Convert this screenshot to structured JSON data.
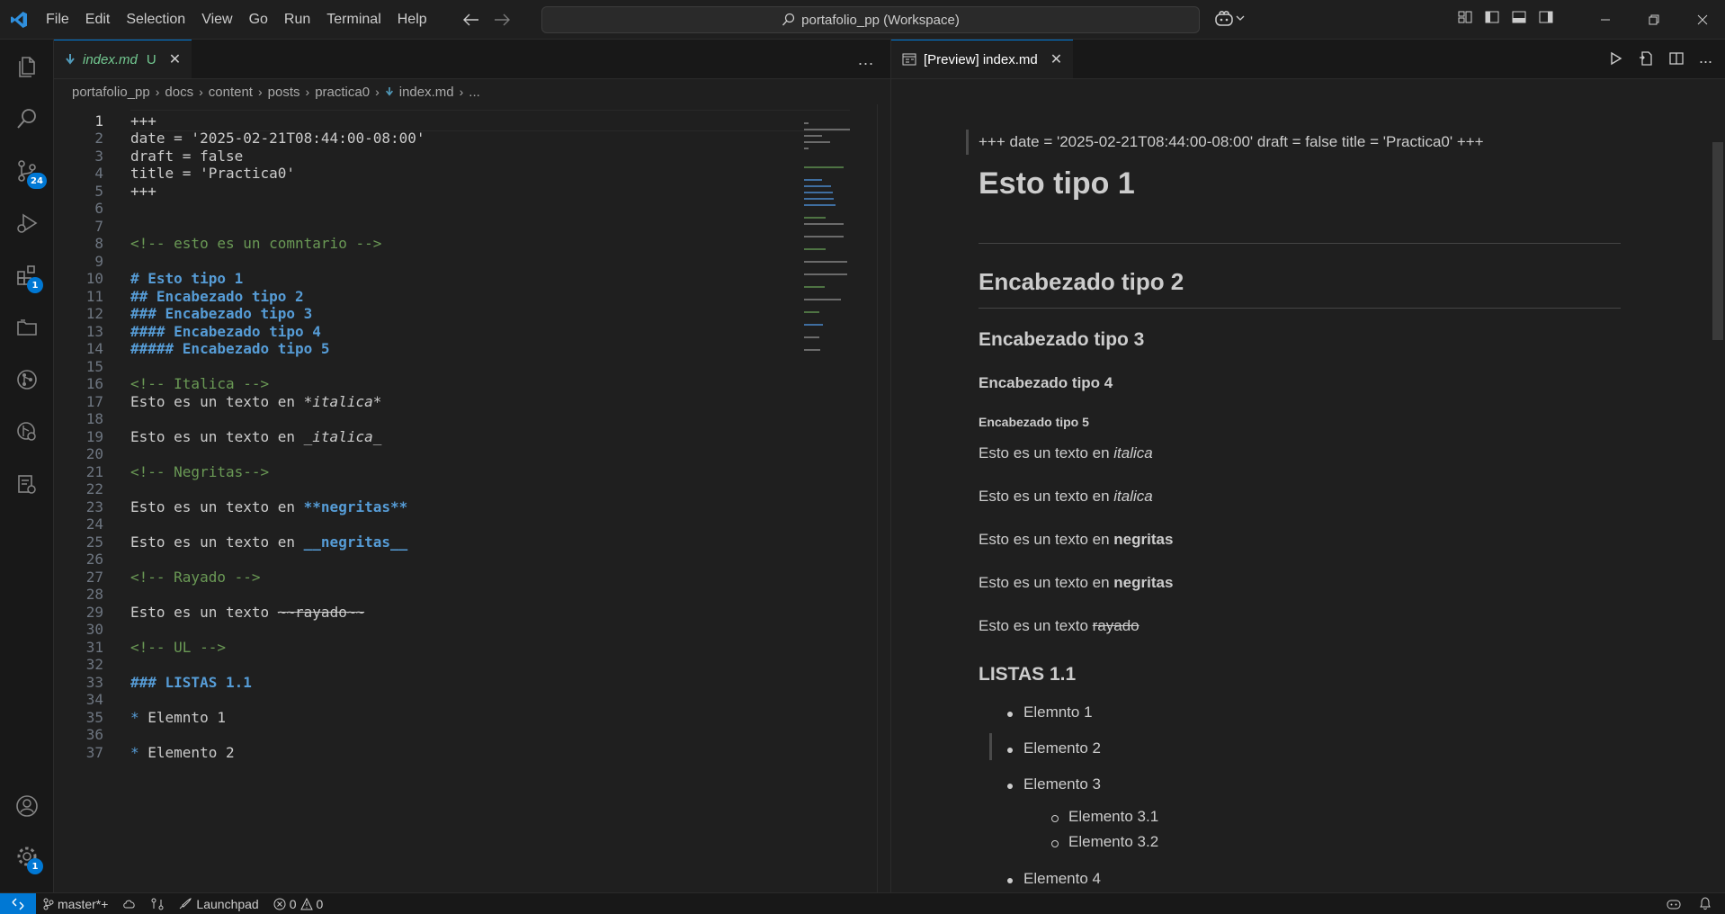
{
  "menu": [
    "File",
    "Edit",
    "Selection",
    "View",
    "Go",
    "Run",
    "Terminal",
    "Help"
  ],
  "search": {
    "text": "portafolio_pp (Workspace)"
  },
  "activity": {
    "scm_badge": "24",
    "extensions_badge": "1",
    "settings_badge": "1"
  },
  "editor": {
    "tab": {
      "title": "index.md",
      "modified": "U"
    },
    "more": "...",
    "breadcrumb": [
      "portafolio_pp",
      "docs",
      "content",
      "posts",
      "practica0",
      "index.md",
      "..."
    ],
    "lines": [
      {
        "n": "1",
        "t": "+++",
        "k": "plain"
      },
      {
        "n": "2",
        "t": "date = '2025-02-21T08:44:00-08:00'",
        "k": "plain"
      },
      {
        "n": "3",
        "t": "draft = false",
        "k": "plain"
      },
      {
        "n": "4",
        "t": "title = 'Practica0'",
        "k": "plain"
      },
      {
        "n": "5",
        "t": "+++",
        "k": "plain"
      },
      {
        "n": "6",
        "t": "",
        "k": "plain"
      },
      {
        "n": "7",
        "t": "",
        "k": "plain"
      },
      {
        "n": "8",
        "t": "<!-- esto es un comntario -->",
        "k": "comment"
      },
      {
        "n": "9",
        "t": "",
        "k": "plain"
      },
      {
        "n": "10",
        "t": "# Esto tipo 1",
        "k": "head"
      },
      {
        "n": "11",
        "t": "## Encabezado tipo 2",
        "k": "head"
      },
      {
        "n": "12",
        "t": "### Encabezado tipo 3",
        "k": "head"
      },
      {
        "n": "13",
        "t": "#### Encabezado tipo 4",
        "k": "head"
      },
      {
        "n": "14",
        "t": "##### Encabezado tipo 5",
        "k": "head"
      },
      {
        "n": "15",
        "t": "",
        "k": "plain"
      },
      {
        "n": "16",
        "t": "<!-- Italica -->",
        "k": "comment"
      },
      {
        "n": "17",
        "pre": "Esto es un texto en ",
        "em": "*italica*",
        "k": "italic"
      },
      {
        "n": "18",
        "t": "",
        "k": "plain"
      },
      {
        "n": "19",
        "pre": "Esto es un texto en ",
        "em": "_italica_",
        "k": "italic"
      },
      {
        "n": "20",
        "t": "",
        "k": "plain"
      },
      {
        "n": "21",
        "t": "<!-- Negritas-->",
        "k": "comment"
      },
      {
        "n": "22",
        "t": "",
        "k": "plain"
      },
      {
        "n": "23",
        "pre": "Esto es un texto en ",
        "em": "**negritas**",
        "k": "bold"
      },
      {
        "n": "24",
        "t": "",
        "k": "plain"
      },
      {
        "n": "25",
        "pre": "Esto es un texto en ",
        "em": "__negritas__",
        "k": "bold"
      },
      {
        "n": "26",
        "t": "",
        "k": "plain"
      },
      {
        "n": "27",
        "t": "<!-- Rayado -->",
        "k": "comment"
      },
      {
        "n": "28",
        "t": "",
        "k": "plain"
      },
      {
        "n": "29",
        "pre": "Esto es un texto ",
        "em": "~~rayado~~",
        "k": "strike"
      },
      {
        "n": "30",
        "t": "",
        "k": "plain"
      },
      {
        "n": "31",
        "t": "<!-- UL -->",
        "k": "comment"
      },
      {
        "n": "32",
        "t": "",
        "k": "plain"
      },
      {
        "n": "33",
        "t": "### LISTAS 1.1",
        "k": "head"
      },
      {
        "n": "34",
        "t": "",
        "k": "plain"
      },
      {
        "n": "35",
        "pre": "* ",
        "em": "Elemnto 1",
        "k": "list"
      },
      {
        "n": "36",
        "t": "",
        "k": "plain"
      },
      {
        "n": "37",
        "pre": "* ",
        "em": "Elemento 2",
        "k": "list"
      }
    ]
  },
  "preview": {
    "tab": "[Preview] index.md",
    "front_matter": "+++ date = '2025-02-21T08:44:00-08:00' draft = false title = 'Practica0' +++",
    "h1": "Esto tipo 1",
    "h2": "Encabezado tipo 2",
    "h3": "Encabezado tipo 3",
    "h4": "Encabezado tipo 4",
    "h5": "Encabezado tipo 5",
    "para_prefix": "Esto es un texto en",
    "para_strike_prefix": "Esto es un texto",
    "italic": "italica",
    "bold": "negritas",
    "strike": "rayado",
    "list_title": "LISTAS 1.1",
    "items": [
      "Elemnto 1",
      "Elemento 2",
      "Elemento 3",
      "Elemento 4"
    ],
    "subitems": [
      "Elemento 3.1",
      "Elemento 3.2"
    ]
  },
  "status": {
    "branch": "master*+",
    "launchpad": "Launchpad",
    "errors": "0",
    "warnings": "0"
  },
  "colors": {
    "accent": "#0078d4",
    "comment": "#6a9955",
    "keyword": "#569cd6",
    "untracked": "#73c991"
  }
}
